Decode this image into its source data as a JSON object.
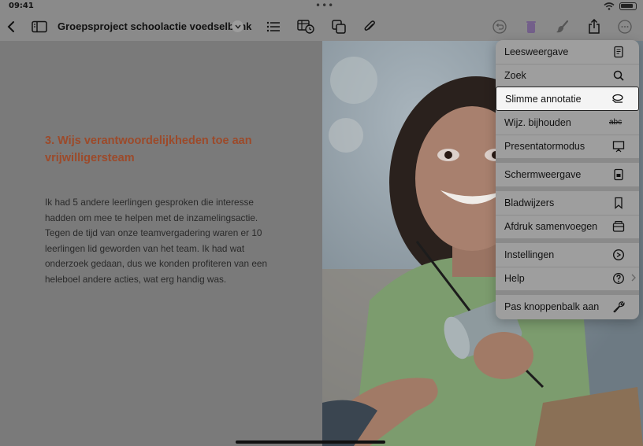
{
  "status_bar": {
    "time": "09:41",
    "dots": "•••"
  },
  "toolbar": {
    "title": "Groepsproject schoolactie voedselbank",
    "icons": [
      "back-chevron-icon",
      "sidebar-icon",
      "list-icon",
      "table-clock-icon",
      "shapes-icon",
      "paperclip-icon",
      "undo-icon",
      "trash-icon",
      "brush-icon",
      "share-icon",
      "more-icon"
    ]
  },
  "document": {
    "heading": "3. Wijs verantwoordelijkheden toe aan vrijwilligersteam",
    "body": "Ik had 5 andere leerlingen gesproken die interesse hadden om mee te helpen met de inzamelingsactie. Tegen de tijd van onze teamvergadering waren er 10 leerlingen lid geworden van het team. Ik had wat onderzoek gedaan, dus we konden profiteren van een heleboel andere acties, wat erg handig was.",
    "heading_color": "#9c4a2a"
  },
  "menu": {
    "items": [
      {
        "label": "Leesweergave",
        "icon": "reading-view-icon"
      },
      {
        "label": "Zoek",
        "icon": "search-icon"
      },
      {
        "label": "Slimme annotatie",
        "icon": "smart-annotation-icon",
        "highlighted": true
      },
      {
        "label": "Wijz. bijhouden",
        "icon": "track-changes-icon",
        "icon_text": "abc"
      },
      {
        "label": "Presentatormodus",
        "icon": "presenter-icon"
      },
      {
        "label": "Schermweergave",
        "icon": "screen-view-icon"
      },
      {
        "label": "Bladwijzers",
        "icon": "bookmark-icon"
      },
      {
        "label": "Afdruk samenvoegen",
        "icon": "mail-merge-icon"
      },
      {
        "label": "Instellingen",
        "icon": "settings-icon"
      },
      {
        "label": "Help",
        "icon": "help-icon",
        "has_submenu": true
      },
      {
        "label": "Pas knoppenbalk aan",
        "icon": "wrench-icon"
      }
    ]
  }
}
